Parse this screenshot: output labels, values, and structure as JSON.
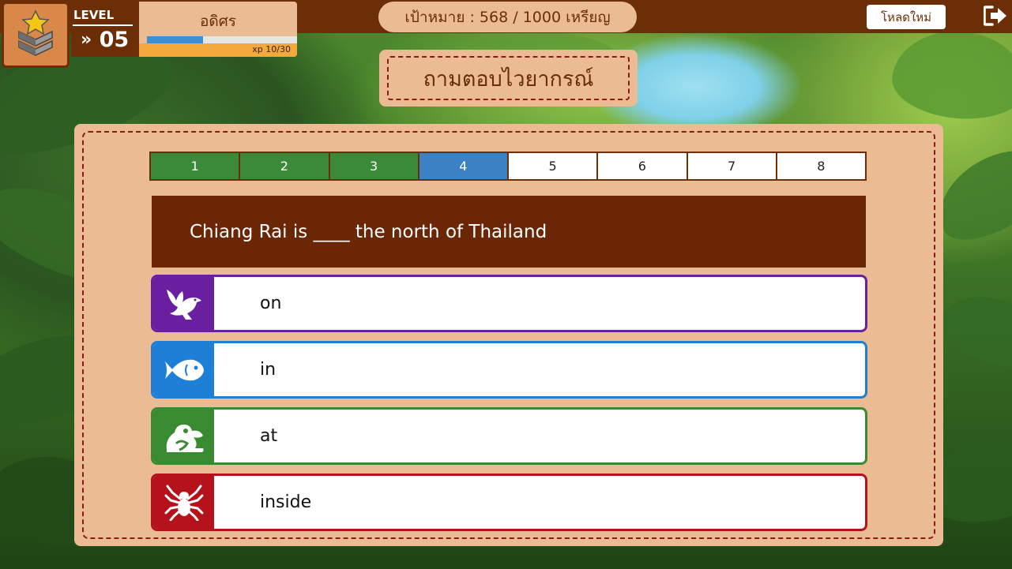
{
  "header": {
    "level_label": "LEVEL",
    "level_number": "05",
    "player_name": "อดิศร",
    "xp_text": "xp 10/30",
    "xp_progress": 0.375,
    "goal_text": "เป้าหมาย : 568 / 1000 เหรียญ",
    "reload_label": "โหลดใหม่",
    "logout_icon": "logout-icon",
    "rank_icon": "rank-chevron-star-icon"
  },
  "game": {
    "title": "ถามตอบไวยากรณ์",
    "steps": [
      {
        "label": "1",
        "state": "done"
      },
      {
        "label": "2",
        "state": "done"
      },
      {
        "label": "3",
        "state": "done"
      },
      {
        "label": "4",
        "state": "current"
      },
      {
        "label": "5",
        "state": "pending"
      },
      {
        "label": "6",
        "state": "pending"
      },
      {
        "label": "7",
        "state": "pending"
      },
      {
        "label": "8",
        "state": "pending"
      }
    ],
    "question": "Chiang Rai is ____  the north of Thailand",
    "options": [
      {
        "label": "on",
        "icon": "bird-icon",
        "color": "#6a1fa0"
      },
      {
        "label": "in",
        "icon": "fish-icon",
        "color": "#1e7fd6"
      },
      {
        "label": "at",
        "icon": "frog-icon",
        "color": "#3a8a32"
      },
      {
        "label": "inside",
        "icon": "spider-icon",
        "color": "#b5121b"
      }
    ]
  },
  "colors": {
    "topbar": "#6b2e07",
    "panel": "#ebbc94",
    "step_done": "#3a8a3a",
    "step_current": "#3a82c4",
    "question_bg": "#6b2705"
  }
}
